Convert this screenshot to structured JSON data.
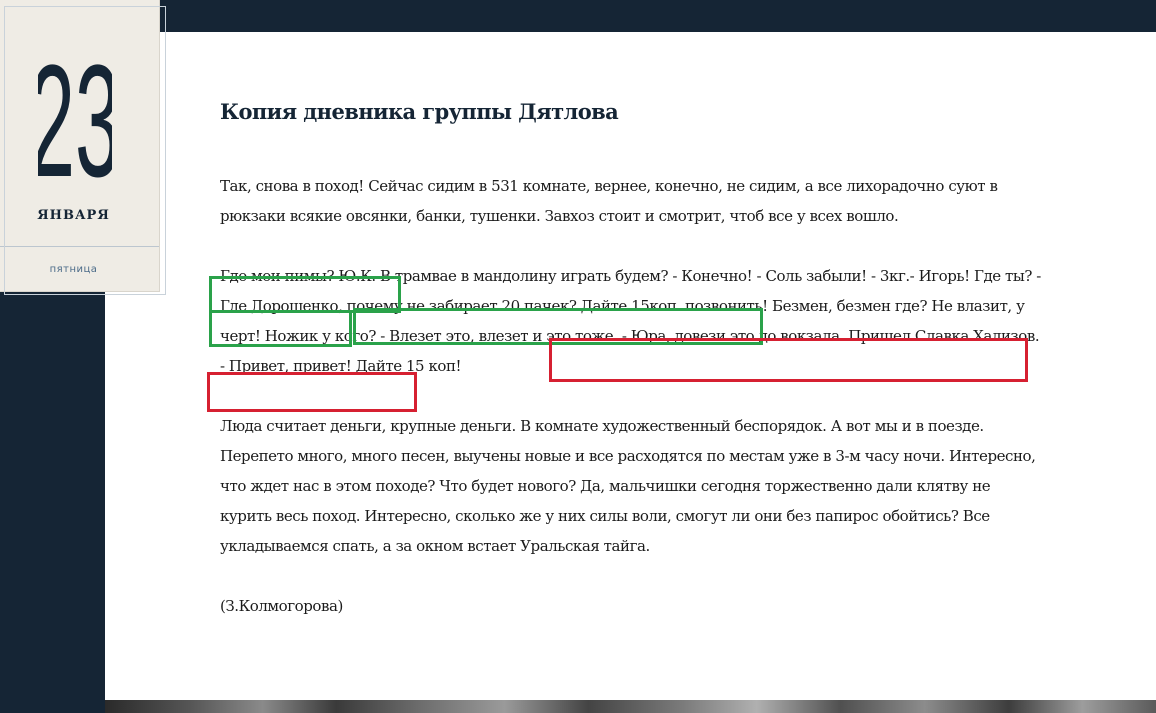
{
  "date_card": {
    "day": "23",
    "month": "ЯНВАРЯ",
    "weekday": "пятница"
  },
  "article": {
    "title": "Копия дневника группы Дятлова",
    "paragraph_1": "Так, снова в поход! Сейчас сидим в 531 комнате, вернее, конечно, не сидим, а все лихорадочно суют в рюкзаки всякие овсянки, банки, тушенки. Завхоз стоит и смотрит, чтоб все у всех вошло.",
    "paragraph_2": "Где мои пимы? Ю.К. В трамвае в мандолину играть будем? - Конечно! - Соль забыли! - 3кг.- Игорь! Где ты? - Где Дорошенко, почему не забирает 20 пачек? Дайте 15коп. позвонить! Безмен, безмен где? Не влазит, у черт! Ножик у кого? - Влезет это, влезет и это тоже. - Юра, довези это до вокзала. Пришел Славка Хализов. - Привет, привет! Дайте 15 коп!",
    "paragraph_3": "Люда считает деньги, крупные деньги. В комнате художественный беспорядок. А вот мы и в поезде. Перепето много, много песен, выучены новые и все расходятся по местам уже в 3-м часу ночи. Интересно, что ждет нас в этом походе? Что будет нового? Да, мальчишки сегодня торжественно дали клятву не курить весь поход. Интересно, сколько же у них силы воли, смогут ли они без папирос обойтись? Все укладываемся спать, а за окном встает Уральская тайга.",
    "signature": "(З.Колмогорова)"
  },
  "highlight_colors": {
    "green": "#2aa24a",
    "red": "#d62031",
    "navy": "#152535"
  }
}
